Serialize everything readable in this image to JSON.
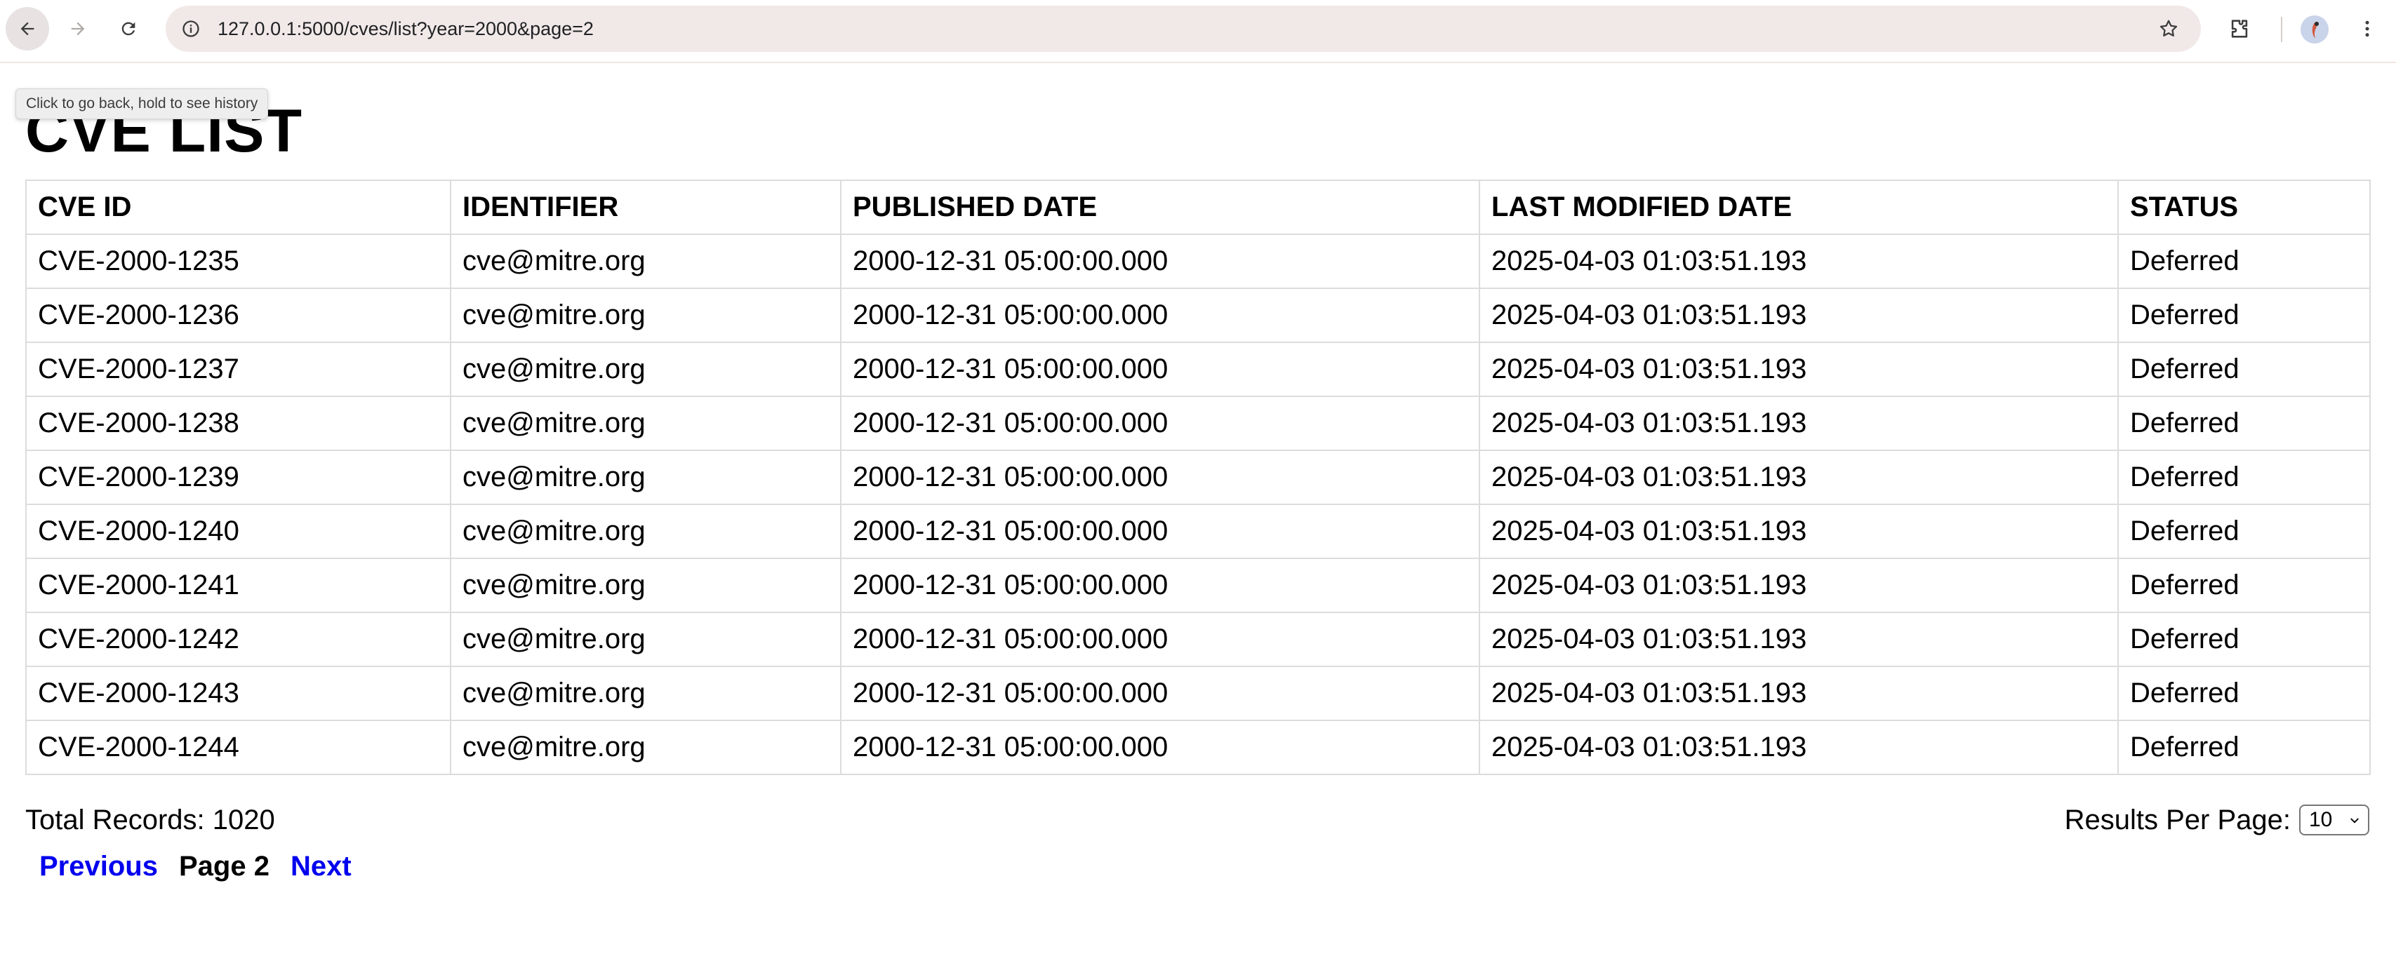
{
  "browser": {
    "url": "127.0.0.1:5000/cves/list?year=2000&page=2",
    "tooltip": "Click to go back, hold to see history"
  },
  "page": {
    "title": "CVE LIST"
  },
  "table": {
    "headers": [
      "CVE ID",
      "IDENTIFIER",
      "PUBLISHED DATE",
      "LAST MODIFIED DATE",
      "STATUS"
    ],
    "rows": [
      [
        "CVE-2000-1235",
        "cve@mitre.org",
        "2000-12-31 05:00:00.000",
        "2025-04-03 01:03:51.193",
        "Deferred"
      ],
      [
        "CVE-2000-1236",
        "cve@mitre.org",
        "2000-12-31 05:00:00.000",
        "2025-04-03 01:03:51.193",
        "Deferred"
      ],
      [
        "CVE-2000-1237",
        "cve@mitre.org",
        "2000-12-31 05:00:00.000",
        "2025-04-03 01:03:51.193",
        "Deferred"
      ],
      [
        "CVE-2000-1238",
        "cve@mitre.org",
        "2000-12-31 05:00:00.000",
        "2025-04-03 01:03:51.193",
        "Deferred"
      ],
      [
        "CVE-2000-1239",
        "cve@mitre.org",
        "2000-12-31 05:00:00.000",
        "2025-04-03 01:03:51.193",
        "Deferred"
      ],
      [
        "CVE-2000-1240",
        "cve@mitre.org",
        "2000-12-31 05:00:00.000",
        "2025-04-03 01:03:51.193",
        "Deferred"
      ],
      [
        "CVE-2000-1241",
        "cve@mitre.org",
        "2000-12-31 05:00:00.000",
        "2025-04-03 01:03:51.193",
        "Deferred"
      ],
      [
        "CVE-2000-1242",
        "cve@mitre.org",
        "2000-12-31 05:00:00.000",
        "2025-04-03 01:03:51.193",
        "Deferred"
      ],
      [
        "CVE-2000-1243",
        "cve@mitre.org",
        "2000-12-31 05:00:00.000",
        "2025-04-03 01:03:51.193",
        "Deferred"
      ],
      [
        "CVE-2000-1244",
        "cve@mitre.org",
        "2000-12-31 05:00:00.000",
        "2025-04-03 01:03:51.193",
        "Deferred"
      ]
    ]
  },
  "footer": {
    "total_records": "Total Records: 1020",
    "results_per_page_label": "Results Per Page:",
    "results_per_page_value": "10"
  },
  "pagination": {
    "previous": "Previous",
    "current": "Page 2",
    "next": "Next"
  },
  "colors": {
    "link": "#0000ee",
    "omnibox_bg": "#f1e9e8",
    "table_border": "#dcdcdc"
  }
}
